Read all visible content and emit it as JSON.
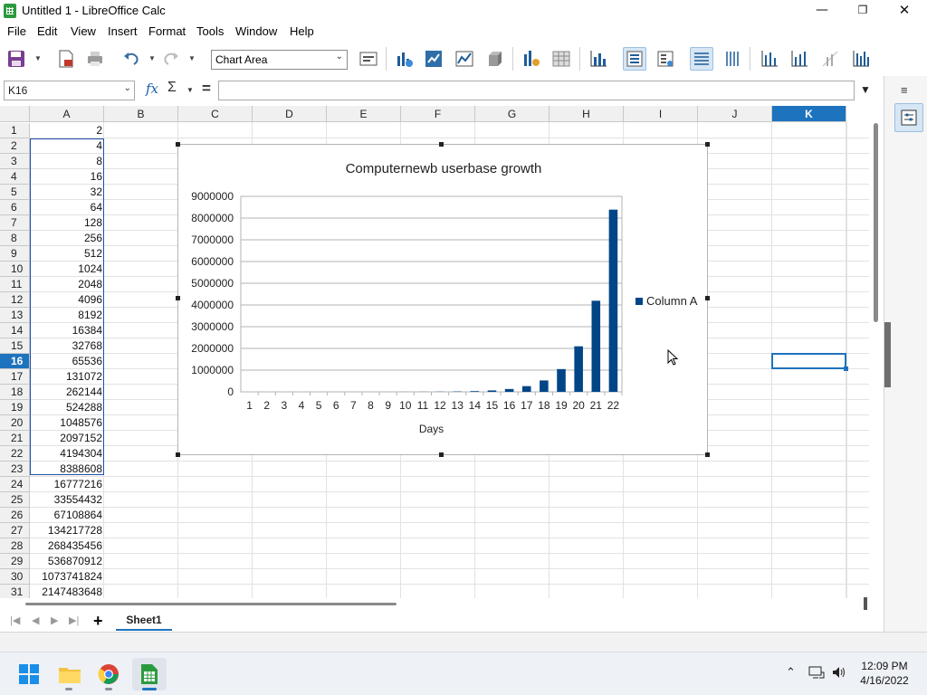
{
  "window": {
    "title": "Untitled 1 - LibreOffice Calc",
    "minimize": "—",
    "maximize": "❐",
    "close": "✕"
  },
  "menu": [
    "File",
    "Edit",
    "View",
    "Insert",
    "Format",
    "Tools",
    "Window",
    "Help"
  ],
  "toolbar": {
    "chart_element_value": "Chart Area"
  },
  "formula_bar": {
    "name_box": "K16",
    "fx": "fx",
    "sigma": "Σ",
    "equals": "=",
    "content": ""
  },
  "grid": {
    "columns": [
      "A",
      "B",
      "C",
      "D",
      "E",
      "F",
      "G",
      "H",
      "I",
      "J",
      "K"
    ],
    "selected_column": "K",
    "rows": [
      "1",
      "2",
      "3",
      "4",
      "5",
      "6",
      "7",
      "8",
      "9",
      "10",
      "11",
      "12",
      "13",
      "14",
      "15",
      "16",
      "17",
      "18",
      "19",
      "20",
      "21",
      "22",
      "23",
      "24",
      "25",
      "26",
      "27",
      "28",
      "29",
      "30",
      "31"
    ],
    "selected_row": "16",
    "column_a_values": [
      "2",
      "4",
      "8",
      "16",
      "32",
      "64",
      "128",
      "256",
      "512",
      "1024",
      "2048",
      "4096",
      "8192",
      "16384",
      "32768",
      "65536",
      "131072",
      "262144",
      "524288",
      "1048576",
      "2097152",
      "4194304",
      "8388608",
      "16777216",
      "33554432",
      "67108864",
      "134217728",
      "268435456",
      "536870912",
      "1073741824",
      "2147483648"
    ]
  },
  "sheet_tabs": {
    "active": "Sheet1",
    "add": "+"
  },
  "chart_data": {
    "type": "bar",
    "title": "Computernewb userbase growth",
    "xlabel": "Days",
    "ylabel": "",
    "categories": [
      "1",
      "2",
      "3",
      "4",
      "5",
      "6",
      "7",
      "8",
      "9",
      "10",
      "11",
      "12",
      "13",
      "14",
      "15",
      "16",
      "17",
      "18",
      "19",
      "20",
      "21",
      "22"
    ],
    "series": [
      {
        "name": "Column A",
        "values": [
          4,
          8,
          16,
          32,
          64,
          128,
          256,
          512,
          1024,
          2048,
          4096,
          8192,
          16384,
          32768,
          65536,
          131072,
          262144,
          524288,
          1048576,
          2097152,
          4194304,
          8388608
        ]
      }
    ],
    "ylim": [
      0,
      9000000
    ],
    "yticks": [
      "0",
      "1000000",
      "2000000",
      "3000000",
      "4000000",
      "5000000",
      "6000000",
      "7000000",
      "8000000",
      "9000000"
    ],
    "grid": true,
    "legend_position": "right",
    "bar_color": "#004586"
  },
  "taskbar": {
    "time": "12:09 PM",
    "date": "4/16/2022",
    "apps": [
      "windows-start",
      "file-explorer",
      "chrome",
      "libreoffice-calc"
    ]
  },
  "colors": {
    "accent": "#1e73be",
    "bar": "#004586"
  }
}
